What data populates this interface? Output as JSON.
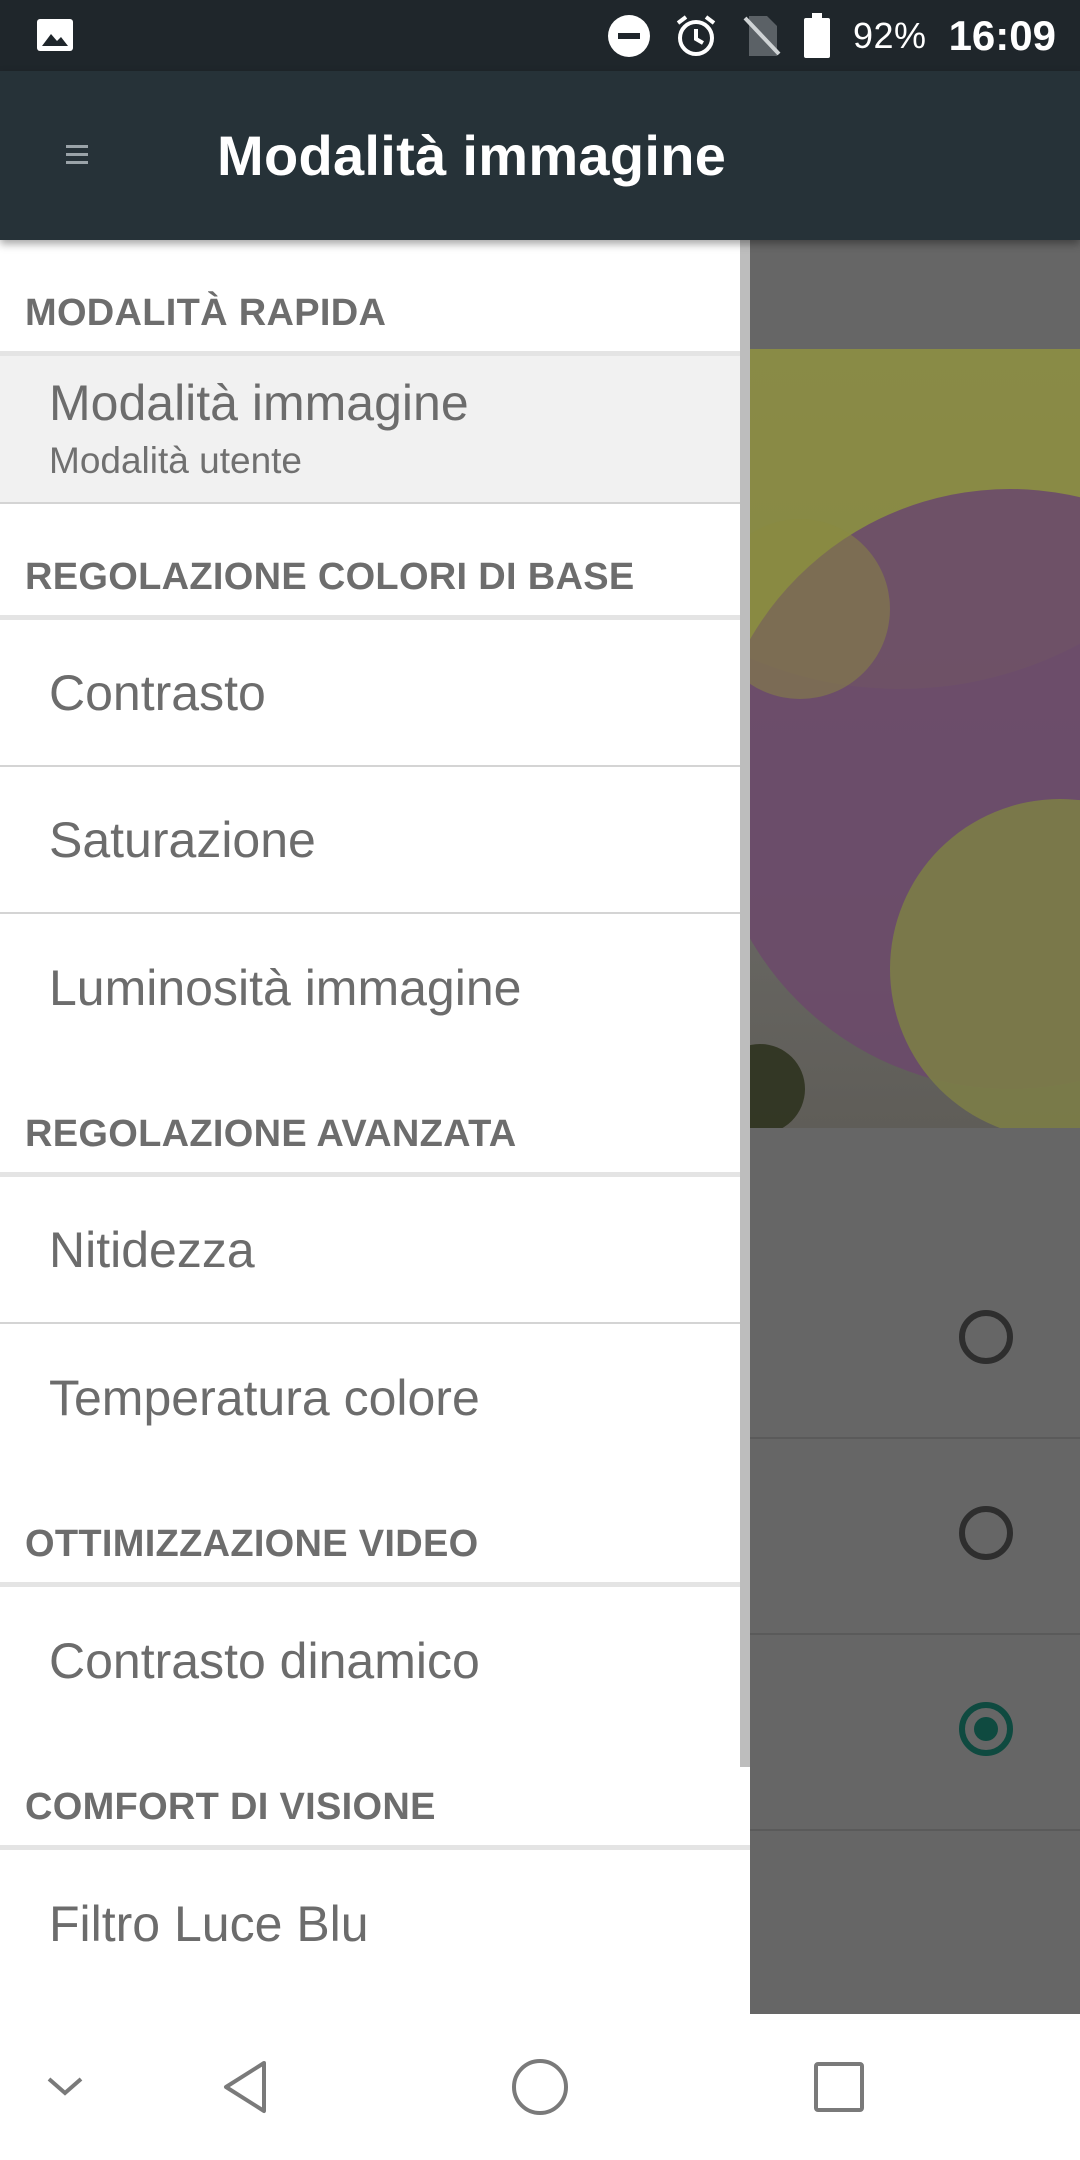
{
  "status_bar": {
    "battery_percent": "92%",
    "time": "16:09"
  },
  "app_bar": {
    "title": "Modalità immagine"
  },
  "drawer": {
    "sections": [
      {
        "header": "MODALITÀ RAPIDA",
        "items": [
          {
            "label": "Modalità immagine",
            "sublabel": "Modalità utente",
            "selected": true
          }
        ]
      },
      {
        "header": "REGOLAZIONE COLORI DI BASE",
        "items": [
          {
            "label": "Contrasto"
          },
          {
            "label": "Saturazione"
          },
          {
            "label": "Luminosità immagine"
          }
        ]
      },
      {
        "header": "REGOLAZIONE AVANZATA",
        "items": [
          {
            "label": "Nitidezza"
          },
          {
            "label": "Temperatura colore"
          }
        ]
      },
      {
        "header": "OTTIMIZZAZIONE VIDEO",
        "items": [
          {
            "label": "Contrasto dinamico"
          }
        ]
      },
      {
        "header": "COMFORT DI VISIONE",
        "items": [
          {
            "label": "Filtro Luce Blu"
          }
        ]
      }
    ]
  },
  "background_options": {
    "radios": [
      {
        "checked": false
      },
      {
        "checked": false
      },
      {
        "checked": true
      }
    ]
  },
  "colors": {
    "status_bar": "#1f262b",
    "app_bar": "#263238",
    "accent_radio": "#0f4a40"
  },
  "icons": {
    "status_left": "image-icon",
    "status_right": [
      "do-not-disturb-icon",
      "alarm-icon",
      "no-sim-icon",
      "battery-icon"
    ],
    "nav": [
      "chevron-down-icon",
      "back-icon",
      "home-icon",
      "recents-icon"
    ]
  }
}
